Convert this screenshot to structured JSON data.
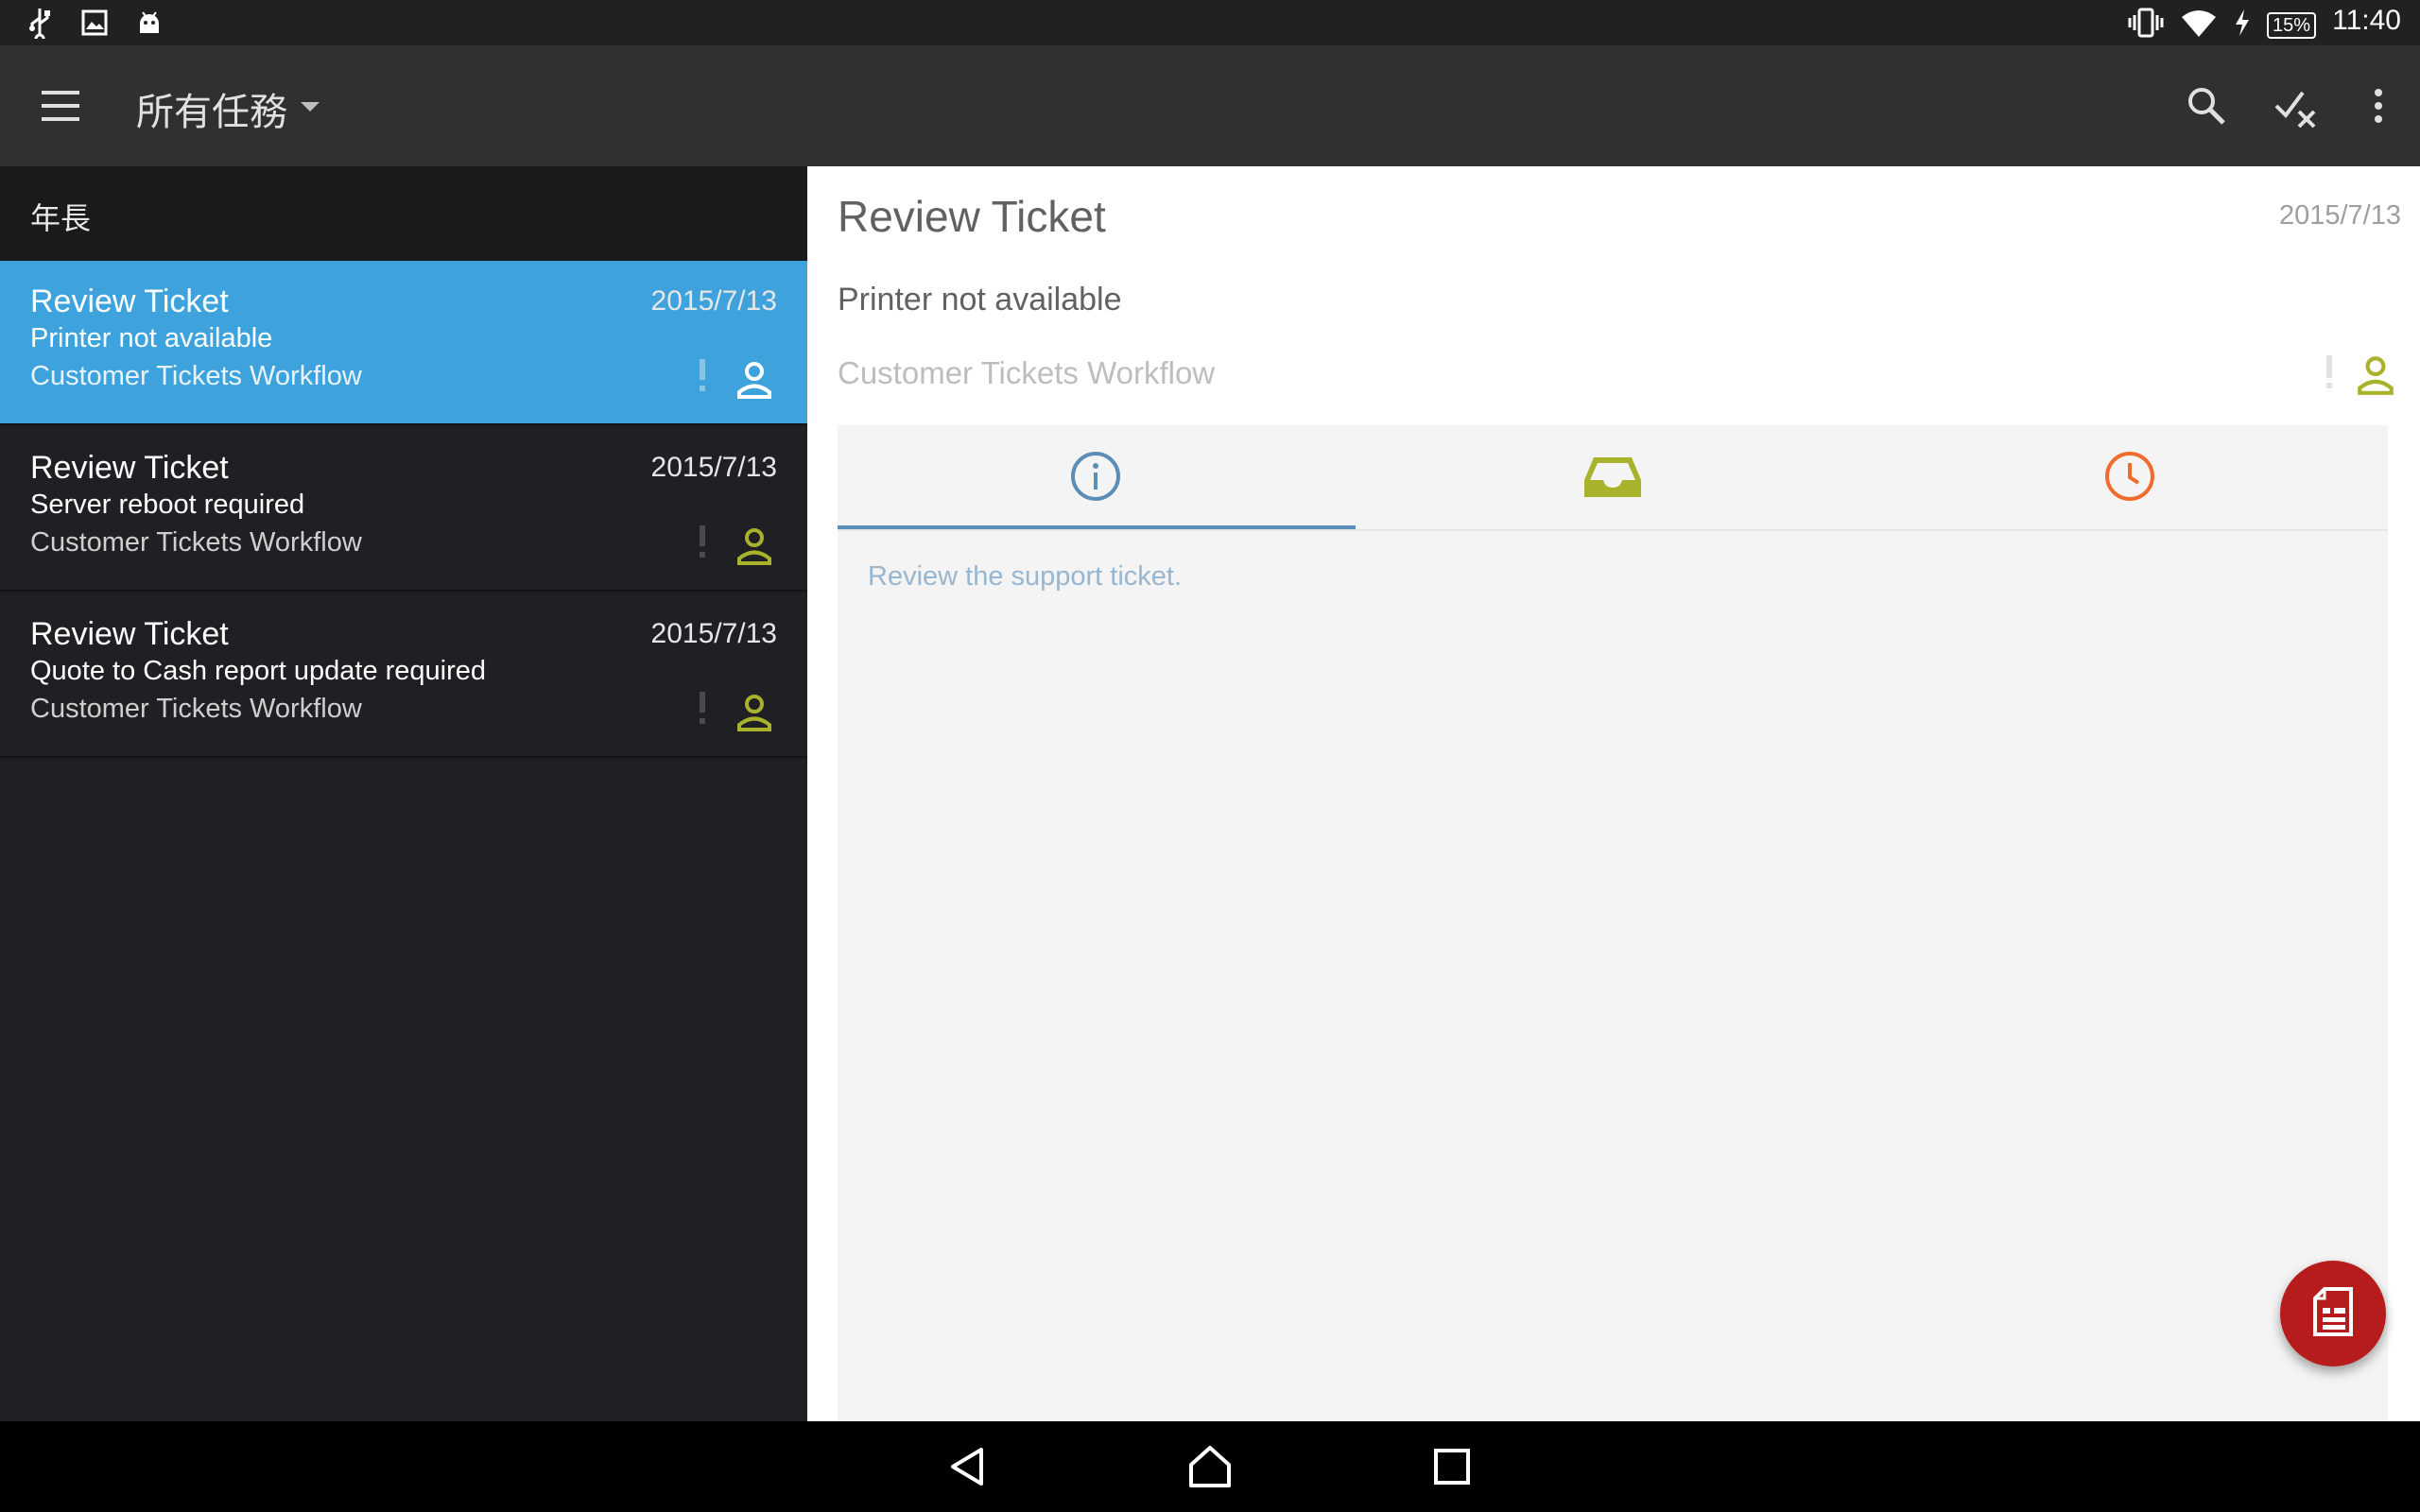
{
  "status_bar": {
    "time": "11:40",
    "battery_percent": "15%",
    "left_icons": [
      "usb-icon",
      "image-icon",
      "android-icon"
    ],
    "right_icons": [
      "vibrate-icon",
      "wifi-icon",
      "charging-icon",
      "battery-icon"
    ]
  },
  "toolbar": {
    "title": "所有任務",
    "icons": [
      "menu-icon",
      "dropdown-caret-icon",
      "search-icon",
      "check-x-icon",
      "overflow-menu-icon"
    ]
  },
  "list": {
    "group_label": "年長",
    "items": [
      {
        "title": "Review Ticket",
        "date": "2015/7/13",
        "subtitle": "Printer not available",
        "workflow": "Customer Tickets Workflow",
        "selected": true
      },
      {
        "title": "Review Ticket",
        "date": "2015/7/13",
        "subtitle": "Server reboot required",
        "workflow": "Customer Tickets Workflow",
        "selected": false
      },
      {
        "title": "Review Ticket",
        "date": "2015/7/13",
        "subtitle": "Quote to Cash report update required",
        "workflow": "Customer Tickets Workflow",
        "selected": false
      }
    ]
  },
  "detail": {
    "title": "Review Ticket",
    "date": "2015/7/13",
    "subtitle": "Printer not available",
    "workflow": "Customer Tickets Workflow",
    "tabs": [
      "info-icon",
      "inbox-icon",
      "clock-icon"
    ],
    "active_tab": 0,
    "description": "Review the support ticket.",
    "fab_icon": "form-document-icon"
  },
  "colors": {
    "selected_row": "#3ea3dc",
    "accent_olive": "#a8b22a",
    "tab_info": "#5b8db8",
    "tab_clock": "#ef6c2c",
    "fab": "#b71c1c"
  },
  "nav_bar": {
    "icons": [
      "back-icon",
      "home-icon",
      "recents-icon"
    ]
  }
}
